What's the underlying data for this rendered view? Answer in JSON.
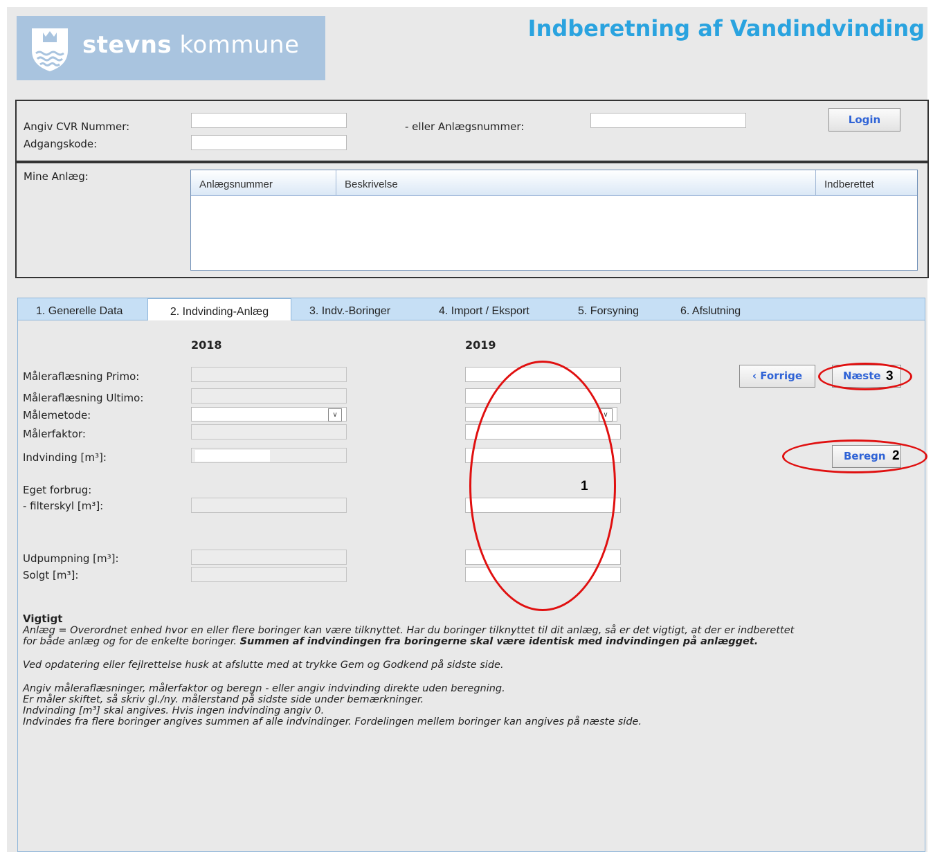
{
  "header": {
    "brand_bold": "stevns",
    "brand_light": " kommune",
    "title": "Indberetning af Vandindvinding"
  },
  "login": {
    "cvr_label": "Angiv CVR Nummer:",
    "anlaeg_label": "- eller Anlægsnummer:",
    "password_label": "Adgangskode:",
    "login_button": "Login"
  },
  "mine_anlaeg": {
    "label": "Mine Anlæg:",
    "columns": [
      "Anlægsnummer",
      "Beskrivelse",
      "Indberettet"
    ]
  },
  "tabs": [
    {
      "label": "1. Generelle Data",
      "active": false
    },
    {
      "label": "2. Indvinding-Anlæg",
      "active": true
    },
    {
      "label": "3. Indv.-Boringer",
      "active": false
    },
    {
      "label": "4. Import / Eksport",
      "active": false
    },
    {
      "label": "5. Forsyning",
      "active": false
    },
    {
      "label": "6. Afslutning",
      "active": false
    }
  ],
  "form": {
    "year_prev": "2018",
    "year_cur": "2019",
    "rows": {
      "primo": "Måleraflæsning Primo:",
      "ultimo": "Måleraflæsning Ultimo:",
      "metode": "Målemetode:",
      "faktor": "Målerfaktor:",
      "indvinding": "Indvinding [m³]:",
      "eget": "Eget forbrug:",
      "filterskyl": "- filterskyl [m³]:",
      "udpumpning": "Udpumpning [m³]:",
      "solgt": "Solgt [m³]:"
    },
    "prev_button": "‹ Forrige",
    "next_button": "Næste",
    "calc_button": "Beregn"
  },
  "annotations": {
    "one": "1",
    "two": "2",
    "three": "3",
    "color": "#e01010"
  },
  "notes": {
    "heading": "Vigtigt",
    "line1": "Anlæg = Overordnet enhed hvor en eller flere boringer kan være tilknyttet. Har du boringer tilknyttet til dit anlæg, så er det vigtigt, at der er indberettet",
    "line2_a": "for både anlæg og for de enkelte boringer. ",
    "line2_b": "Summen af indvindingen fra boringerne skal være identisk med indvindingen på anlægget.",
    "line3": "Ved opdatering eller fejlrettelse husk at afslutte med at trykke Gem og Godkend på sidste side.",
    "line4": "Angiv måleraflæsninger, målerfaktor og beregn - eller angiv indvinding direkte uden beregning.",
    "line5": "Er måler skiftet, så skriv gl./ny. målerstand på sidste side under bemærkninger.",
    "line6": "Indvinding [m³] skal angives. Hvis ingen indvinding angiv 0.",
    "line7": "Indvindes fra flere boringer angives summen af alle indvindinger. Fordelingen mellem boringer kan angives på næste side."
  },
  "colors": {
    "title": "#2aa3df",
    "logo_bg": "#a9c4df",
    "tab_bg": "#c6dff5",
    "button_text": "#2f63d6"
  }
}
